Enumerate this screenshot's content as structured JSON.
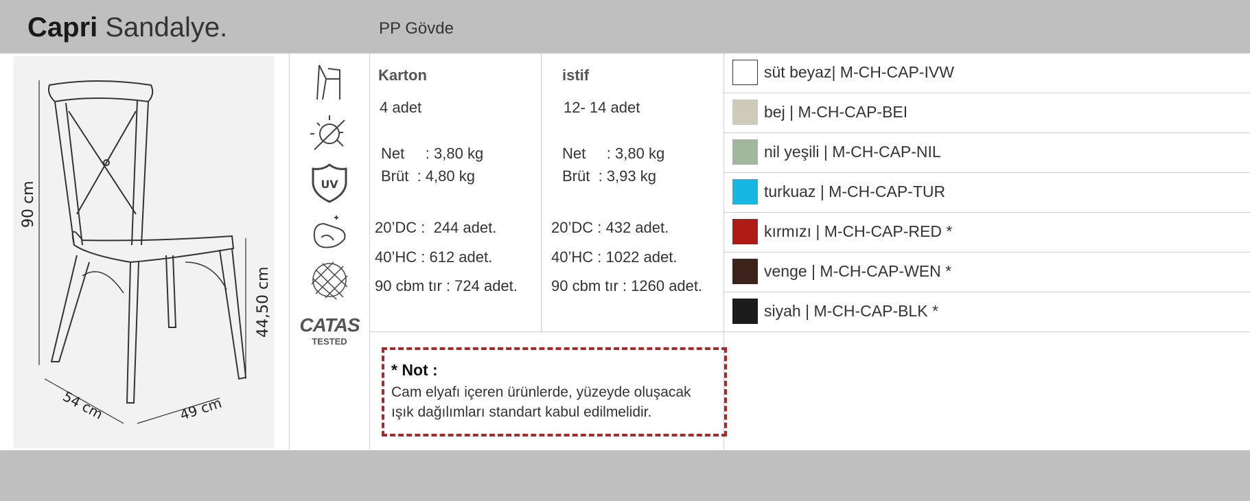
{
  "header": {
    "title_bold": "Capri",
    "title_light": "Sandalye.",
    "subtitle": "PP Gövde"
  },
  "dimensions": {
    "height": "90 cm",
    "seat_height": "44,50 cm",
    "depth": "54 cm",
    "width": "49 cm"
  },
  "feature_icons": [
    "stackable-chair-icon",
    "weather-resistant-icon",
    "uv-protection-icon",
    "easy-clean-icon",
    "fiberglass-icon",
    "catas-tested-logo"
  ],
  "catas": {
    "brand": "CATAS",
    "tested": "TESTED"
  },
  "karton": {
    "heading": "Karton",
    "qty": "4 adet",
    "net": "Net     : 3,80 kg",
    "brut": "Brüt  : 4,80 kg",
    "dc20": "20’DC :  244 adet.",
    "hc40": "40’HC : 612 adet.",
    "tir": "90 cbm tır : 724 adet."
  },
  "istif": {
    "heading": "istif",
    "qty": "12- 14 adet",
    "net": "Net     : 3,80 kg",
    "brut": "Brüt  : 3,93 kg",
    "dc20": "20’DC : 432 adet.",
    "hc40": "40’HC : 1022 adet.",
    "tir": "90 cbm tır : 1260 adet."
  },
  "note": {
    "title": "* Not :",
    "line1": "Cam elyafı içeren ürünlerde, yüzeyde oluşacak",
    "line2": "ışık dağılımları standart kabul edilmelidir."
  },
  "colors": [
    {
      "label": "süt beyaz| M-CH-CAP-IVW",
      "hex": "#ffffff"
    },
    {
      "label": "bej | M-CH-CAP-BEI",
      "hex": "#cfcbbb"
    },
    {
      "label": "nil yeşili | M-CH-CAP-NIL",
      "hex": "#a2b89d"
    },
    {
      "label": "turkuaz | M-CH-CAP-TUR",
      "hex": "#16b7e0"
    },
    {
      "label": "kırmızı | M-CH-CAP-RED *",
      "hex": "#b01c15"
    },
    {
      "label": "venge | M-CH-CAP-WEN *",
      "hex": "#3d231c"
    },
    {
      "label": "siyah | M-CH-CAP-BLK *",
      "hex": "#1c1c1c"
    }
  ],
  "accent": {
    "note_border": "#a52a2a"
  }
}
